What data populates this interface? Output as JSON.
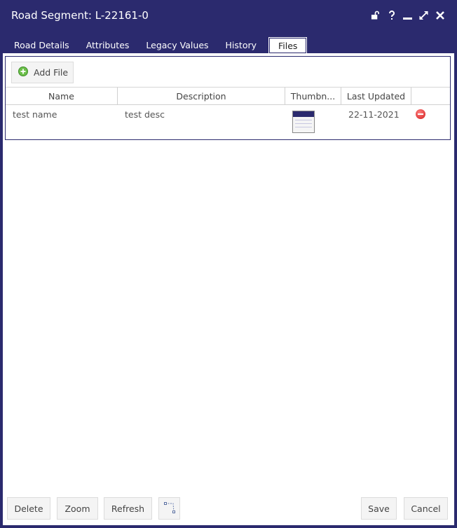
{
  "window": {
    "title": "Road Segment: L-22161-0",
    "tools": [
      "unlock-icon",
      "help-icon",
      "minimize-icon",
      "maximize-icon",
      "close-icon"
    ]
  },
  "tabs": [
    {
      "label": "Road Details"
    },
    {
      "label": "Attributes"
    },
    {
      "label": "Legacy Values"
    },
    {
      "label": "History"
    },
    {
      "label": "Files"
    }
  ],
  "files": {
    "add_label": "Add File",
    "columns": [
      "Name",
      "Description",
      "Thumbn...",
      "Last Updated"
    ],
    "rows": [
      {
        "name": "test name",
        "description": "test desc",
        "last_updated": "22-11-2021"
      }
    ]
  },
  "footer": {
    "delete": "Delete",
    "zoom": "Zoom",
    "refresh": "Refresh",
    "save": "Save",
    "cancel": "Cancel"
  },
  "colors": {
    "header": "#2b2a6e",
    "remove": "#d11c1c",
    "add": "#4caf50"
  }
}
